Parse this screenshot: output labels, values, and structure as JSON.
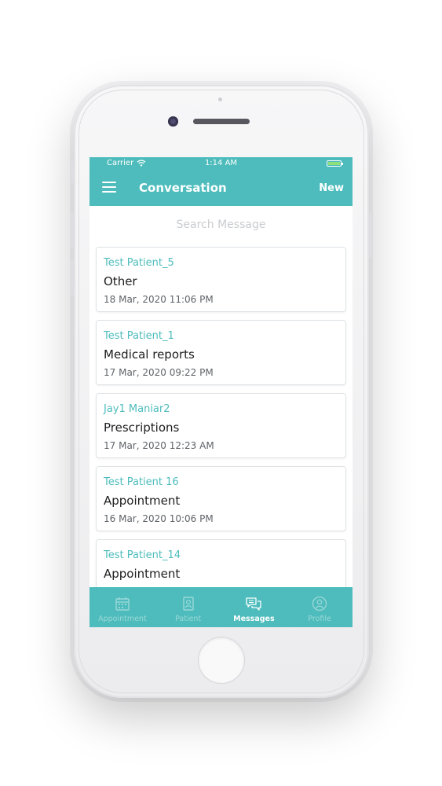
{
  "status_bar": {
    "carrier": "Carrier",
    "time": "1:14 AM"
  },
  "header": {
    "title": "Conversation",
    "new_label": "New"
  },
  "search": {
    "placeholder": "Search Message"
  },
  "conversations": [
    {
      "patient": "Test Patient_5",
      "subject": "Other",
      "date": "18 Mar, 2020 11:06 PM"
    },
    {
      "patient": "Test Patient_1",
      "subject": "Medical reports",
      "date": "17 Mar, 2020 09:22 PM"
    },
    {
      "patient": "Jay1 Maniar2",
      "subject": "Prescriptions",
      "date": "17 Mar, 2020 12:23 AM"
    },
    {
      "patient": "Test Patient 16",
      "subject": "Appointment",
      "date": "16 Mar, 2020 10:06 PM"
    },
    {
      "patient": "Test Patient_14",
      "subject": "Appointment",
      "date": ""
    }
  ],
  "tabs": [
    {
      "label": "Appointment",
      "icon": "calendar-icon",
      "active": false
    },
    {
      "label": "Patient",
      "icon": "patient-record-icon",
      "active": false
    },
    {
      "label": "Messages",
      "icon": "chat-bubbles-icon",
      "active": true
    },
    {
      "label": "Profile",
      "icon": "profile-icon",
      "active": false
    }
  ],
  "colors": {
    "accent": "#4ebcbc",
    "patient_name": "#4ebcbc",
    "battery": "#8ee07a"
  }
}
